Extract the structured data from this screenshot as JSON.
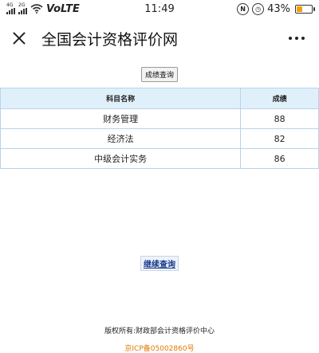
{
  "status_bar": {
    "network_top": "4G",
    "network_2g": "2G",
    "volte": "VoLTE",
    "time": "11:49",
    "battery_pct": "43%",
    "battery_level": 0.43,
    "icons": [
      "signal-icon",
      "wifi-icon",
      "nfc-icon",
      "alarm-icon",
      "battery-icon"
    ]
  },
  "header": {
    "title": "全国会计资格评价网",
    "icons": [
      "close-icon",
      "more-icon"
    ]
  },
  "query_button": {
    "label": "成绩查询"
  },
  "table": {
    "headers": [
      "科目名称",
      "成绩"
    ],
    "rows": [
      [
        "财务管理",
        "88"
      ],
      [
        "经济法",
        "82"
      ],
      [
        "中级会计实务",
        "86"
      ]
    ]
  },
  "continue_button": {
    "label": "继续查询"
  },
  "footer": {
    "copyright": "版权所有:财政部会计资格评价中心",
    "icp": "京ICP备05002860号"
  },
  "colors": {
    "table_header_bg": "#e0f0fb",
    "table_border": "#b7d3ea",
    "icp_color": "#e07b00",
    "link_color": "#1a3c8c"
  }
}
